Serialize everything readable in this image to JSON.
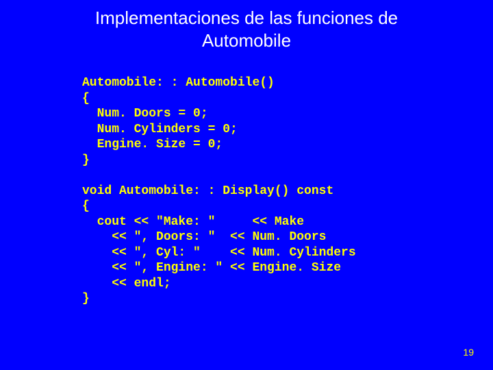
{
  "title_line1": "Implementaciones de las funciones de",
  "title_line2": "Automobile",
  "code": {
    "l01": "Automobile: : Automobile()",
    "l02": "{",
    "l03": "  Num. Doors = 0;",
    "l04": "  Num. Cylinders = 0;",
    "l05": "  Engine. Size = 0;",
    "l06": "}",
    "l07": "",
    "l08": "void Automobile: : Display() const",
    "l09": "{",
    "l10": "  cout << \"Make: \"     << Make",
    "l11": "    << \", Doors: \"  << Num. Doors",
    "l12": "    << \", Cyl: \"    << Num. Cylinders",
    "l13": "    << \", Engine: \" << Engine. Size",
    "l14": "    << endl;",
    "l15": "}"
  },
  "page_number": "19"
}
